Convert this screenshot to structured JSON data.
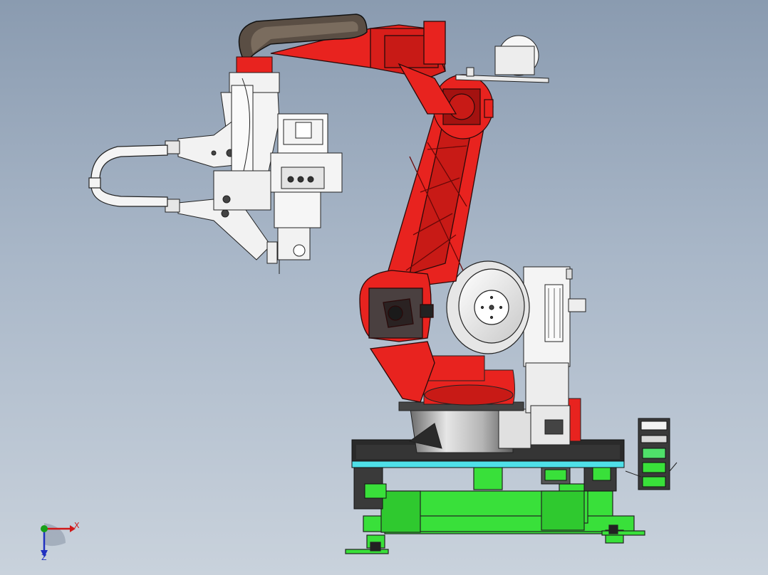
{
  "viewport": {
    "background_top": "#8a9bb0",
    "background_bottom": "#c9d2dc"
  },
  "model": {
    "parts": [
      "spot-welding-gun",
      "robot-arm",
      "motor-disc",
      "servo-motor-pack",
      "rotating-base",
      "cyan-plate",
      "green-track-frame",
      "cable-chain"
    ],
    "colors": {
      "arm_red": "#e8231f",
      "arm_dark_red": "#a31210",
      "gun_white": "#f2f2f2",
      "frame_green": "#39e03a",
      "plate_cyan": "#4fe0e8",
      "base_silver": "#c4c4c4",
      "outline": "#222222"
    }
  },
  "triad": {
    "x_label": "X",
    "z_label": "Z",
    "x_color": "#d01818",
    "y_color": "#18a018",
    "z_color": "#2030c0"
  }
}
